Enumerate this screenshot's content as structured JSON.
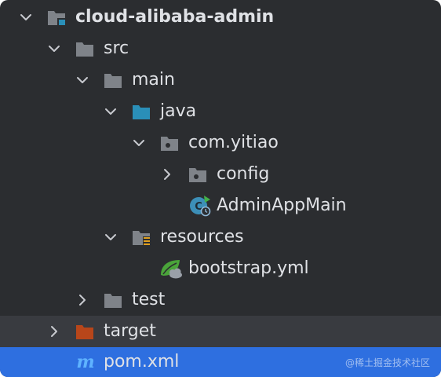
{
  "tree": {
    "root": {
      "label": "cloud-alibaba-admin",
      "icon": "module-folder-icon",
      "expanded": true
    },
    "src": {
      "label": "src",
      "icon": "folder-icon",
      "expanded": true
    },
    "main": {
      "label": "main",
      "icon": "folder-icon",
      "expanded": true
    },
    "java": {
      "label": "java",
      "icon": "source-root-folder-icon",
      "expanded": true
    },
    "package": {
      "label": "com.yitiao",
      "icon": "package-icon",
      "expanded": true
    },
    "config": {
      "label": "config",
      "icon": "package-icon",
      "expanded": false
    },
    "admin_app_main": {
      "label": "AdminAppMain",
      "icon": "spring-boot-class-icon"
    },
    "resources": {
      "label": "resources",
      "icon": "resources-folder-icon",
      "expanded": true
    },
    "bootstrap": {
      "label": "bootstrap.yml",
      "icon": "spring-config-file-icon"
    },
    "test": {
      "label": "test",
      "icon": "folder-icon",
      "expanded": false
    },
    "target": {
      "label": "target",
      "icon": "excluded-folder-icon",
      "expanded": false
    },
    "pom": {
      "label": "pom.xml",
      "icon": "maven-icon",
      "selected": true
    }
  },
  "watermark": "@稀土掘金技术社区",
  "colors": {
    "background": "#2b2d30",
    "hover_row": "#393b40",
    "selected_row": "#2e6fe0",
    "folder": "#7f8389",
    "source_root": "#2a8fb8",
    "excluded": "#b8461a",
    "text": "#dfe1e5"
  }
}
